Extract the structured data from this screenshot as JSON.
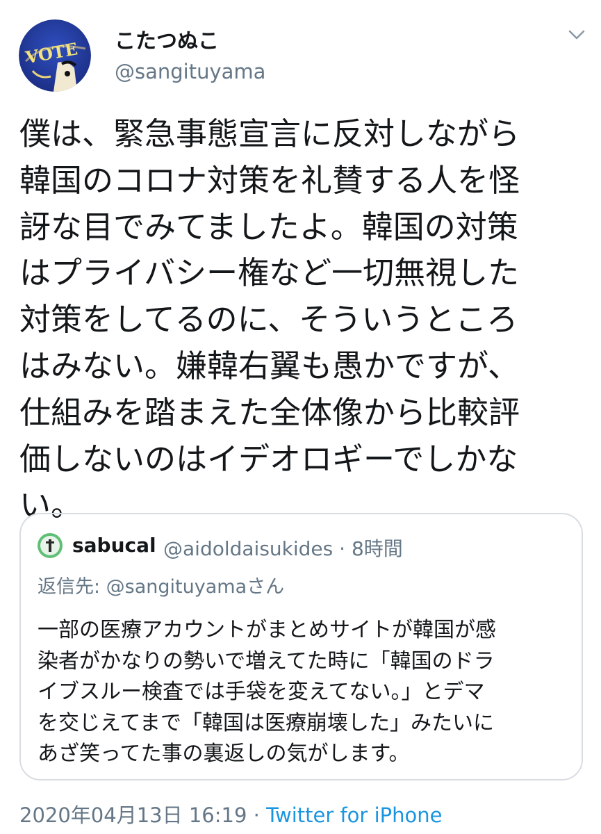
{
  "author": {
    "display_name": "こたつぬこ",
    "handle": "@sangituyama",
    "avatar_icon": "vote-avatar-icon",
    "avatar_text": "VOTE"
  },
  "tweet": {
    "text": "僕は、緊急事態宣言に反対しながら\n韓国のコロナ対策を礼賛する人を怪\n訝な目でみてましたよ。韓国の対策\nはプライバシー権など一切無視した\n対策をしてるのに、そういうところ\nはみない。嫌韓右翼も愚かですが、\n仕組みを踏まえた全体像から比較評\n価しないのはイデオロギーでしかな\nい。"
  },
  "quote": {
    "name": "sabucal",
    "meta": "@aidoldaisukides · 8時間",
    "reply_to": "返信先: @sangituyamaさん",
    "text": "一部の医療アカウントがまとめサイトが韓国が感\n染者がかなりの勢いで増えてた時に「韓国のドラ\nイブスルー検査では手袋を変えてない。」とデマ\nを交じえてまで「韓国は医療崩壊した」みたいに\nあざ笑ってた事の裏返しの気がします。"
  },
  "footer": {
    "timestamp": "2020年04月13日 16:19 · ",
    "source": "Twitter for iPhone"
  },
  "colors": {
    "text": "#14171a",
    "secondary": "#657786",
    "link": "#1b95e0",
    "border": "#d8dde2"
  }
}
